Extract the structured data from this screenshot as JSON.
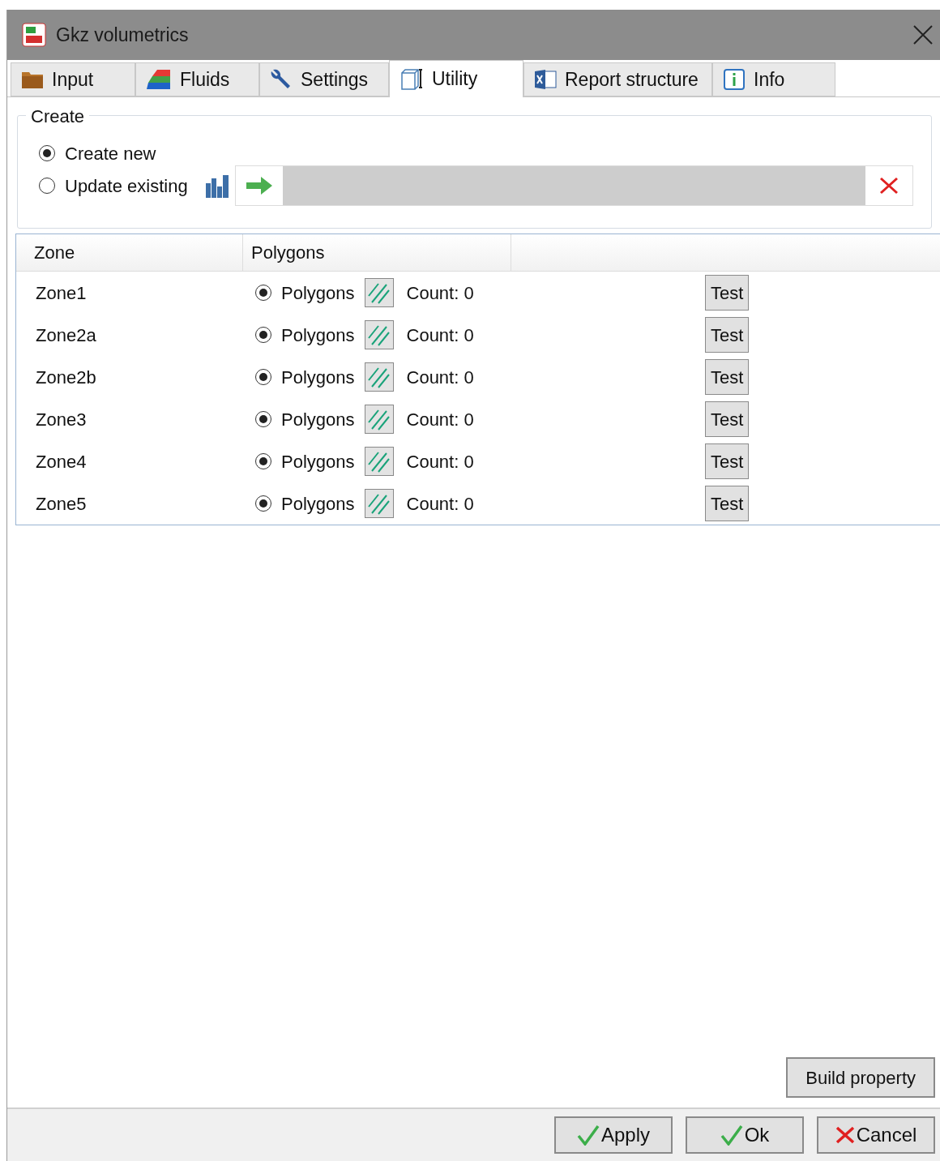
{
  "window": {
    "title": "Gkz volumetrics"
  },
  "tabs": [
    {
      "label": "Input",
      "selected": false
    },
    {
      "label": "Fluids",
      "selected": false
    },
    {
      "label": "Settings",
      "selected": false
    },
    {
      "label": "Utility",
      "selected": true
    },
    {
      "label": "Report structure",
      "selected": false
    },
    {
      "label": "Info",
      "selected": false
    }
  ],
  "create": {
    "legend": "Create",
    "options": [
      {
        "label": "Create new",
        "selected": true
      },
      {
        "label": "Update existing",
        "selected": false
      }
    ]
  },
  "table": {
    "columns": [
      "Zone",
      "Polygons"
    ],
    "rows": [
      {
        "zone": "Zone1",
        "option": "Polygons",
        "selected": true,
        "count": "Count: 0",
        "button": "Test"
      },
      {
        "zone": "Zone2a",
        "option": "Polygons",
        "selected": true,
        "count": "Count: 0",
        "button": "Test"
      },
      {
        "zone": "Zone2b",
        "option": "Polygons",
        "selected": true,
        "count": "Count: 0",
        "button": "Test"
      },
      {
        "zone": "Zone3",
        "option": "Polygons",
        "selected": true,
        "count": "Count: 0",
        "button": "Test"
      },
      {
        "zone": "Zone4",
        "option": "Polygons",
        "selected": true,
        "count": "Count: 0",
        "button": "Test"
      },
      {
        "zone": "Zone5",
        "option": "Polygons",
        "selected": true,
        "count": "Count: 0",
        "button": "Test"
      }
    ]
  },
  "build_button": "Build property",
  "buttons": [
    {
      "label": "Apply",
      "kind": "ok"
    },
    {
      "label": "Ok",
      "kind": "ok"
    },
    {
      "label": "Cancel",
      "kind": "cancel"
    }
  ]
}
